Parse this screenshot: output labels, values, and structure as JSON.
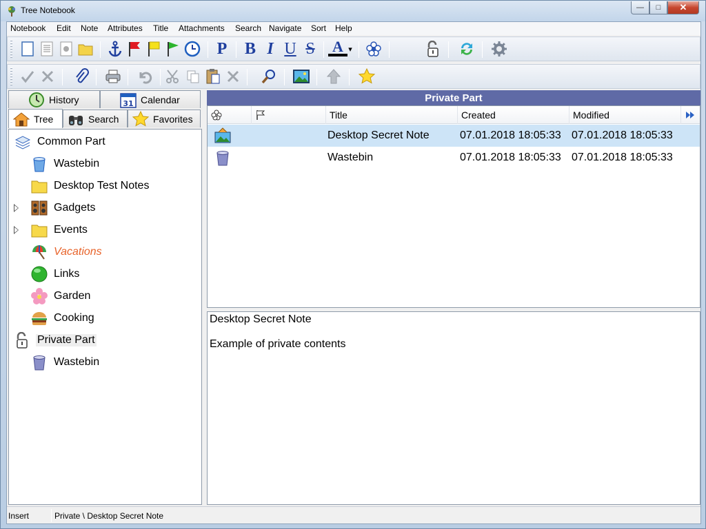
{
  "window": {
    "title": "Tree Notebook",
    "minimize_glyph": "—",
    "maximize_glyph": "□",
    "close_glyph": "✕"
  },
  "menu": {
    "items": [
      "Notebook",
      "Edit",
      "Note",
      "Attributes",
      "Title",
      "Attachments",
      "Search",
      "Navigate",
      "Sort",
      "Help"
    ]
  },
  "toolbar1": {
    "paragraph_glyph": "P",
    "bold_glyph": "B",
    "italic_glyph": "I",
    "underline_glyph": "U",
    "strike_glyph": "S",
    "font_color_glyph": "A",
    "dropdown_glyph": "▾"
  },
  "left_tabs": {
    "history": "History",
    "calendar": "Calendar",
    "tree": "Tree",
    "search": "Search",
    "favorites": "Favorites"
  },
  "tree": {
    "items": [
      {
        "label": "Common Part",
        "icon": "stack-icon"
      },
      {
        "label": "Wastebin",
        "icon": "wastebin-blue-icon"
      },
      {
        "label": "Desktop Test Notes",
        "icon": "folder-icon"
      },
      {
        "label": "Gadgets",
        "icon": "speakers-icon"
      },
      {
        "label": "Events",
        "icon": "folder-icon"
      },
      {
        "label": "Vacations",
        "icon": "umbrella-icon"
      },
      {
        "label": "Links",
        "icon": "green-ball-icon"
      },
      {
        "label": "Garden",
        "icon": "flower-icon"
      },
      {
        "label": "Cooking",
        "icon": "burger-icon"
      },
      {
        "label": "Private Part",
        "icon": "padlock-open-icon"
      },
      {
        "label": "Wastebin",
        "icon": "wastebin-purple-icon"
      }
    ]
  },
  "list": {
    "header": "Private Part",
    "columns": {
      "title": "Title",
      "created": "Created",
      "modified": "Modified"
    },
    "rows": [
      {
        "title": "Desktop Secret Note",
        "created": "07.01.2018 18:05:33",
        "modified": "07.01.2018 18:05:33",
        "icon": "picture-note-icon"
      },
      {
        "title": "Wastebin",
        "created": "07.01.2018 18:05:33",
        "modified": "07.01.2018 18:05:33",
        "icon": "wastebin-purple-icon"
      }
    ]
  },
  "note": {
    "title": "Desktop Secret Note",
    "content": "Example of private contents"
  },
  "status": {
    "mode": "Insert",
    "path": "Private \\ Desktop Secret Note"
  },
  "colors": {
    "section_header_bg": "#5f6aa6",
    "selected_row_bg": "#cde4f7",
    "vacations_text": "#e8632a",
    "toolbar_blue": "#1f3f9e"
  }
}
